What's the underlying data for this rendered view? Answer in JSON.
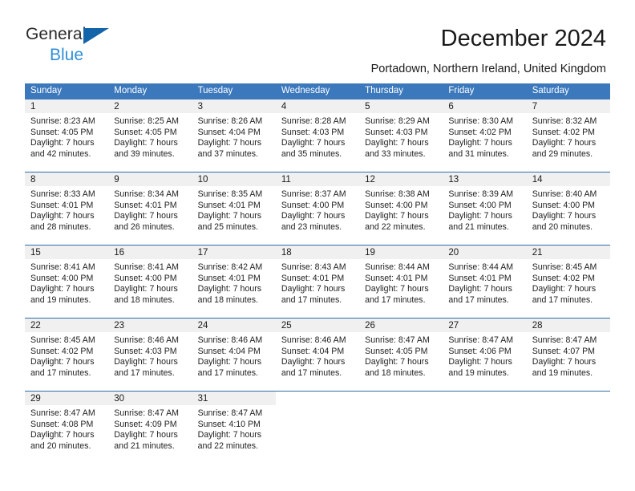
{
  "brand": {
    "name_part1": "General",
    "name_part2": "Blue",
    "triangle_color": "#1464aa",
    "blue_text_color": "#2f8fd8"
  },
  "header": {
    "title": "December 2024",
    "subtitle": "Portadown, Northern Ireland, United Kingdom"
  },
  "theme": {
    "header_row_bg": "#3b78bc",
    "row_separator": "#2e6da8",
    "daynum_bg": "#f0f0f0"
  },
  "weekdays": [
    "Sunday",
    "Monday",
    "Tuesday",
    "Wednesday",
    "Thursday",
    "Friday",
    "Saturday"
  ],
  "weeks": [
    [
      {
        "day": "1",
        "sunrise": "Sunrise: 8:23 AM",
        "sunset": "Sunset: 4:05 PM",
        "daylight_line1": "Daylight: 7 hours",
        "daylight_line2": "and 42 minutes."
      },
      {
        "day": "2",
        "sunrise": "Sunrise: 8:25 AM",
        "sunset": "Sunset: 4:05 PM",
        "daylight_line1": "Daylight: 7 hours",
        "daylight_line2": "and 39 minutes."
      },
      {
        "day": "3",
        "sunrise": "Sunrise: 8:26 AM",
        "sunset": "Sunset: 4:04 PM",
        "daylight_line1": "Daylight: 7 hours",
        "daylight_line2": "and 37 minutes."
      },
      {
        "day": "4",
        "sunrise": "Sunrise: 8:28 AM",
        "sunset": "Sunset: 4:03 PM",
        "daylight_line1": "Daylight: 7 hours",
        "daylight_line2": "and 35 minutes."
      },
      {
        "day": "5",
        "sunrise": "Sunrise: 8:29 AM",
        "sunset": "Sunset: 4:03 PM",
        "daylight_line1": "Daylight: 7 hours",
        "daylight_line2": "and 33 minutes."
      },
      {
        "day": "6",
        "sunrise": "Sunrise: 8:30 AM",
        "sunset": "Sunset: 4:02 PM",
        "daylight_line1": "Daylight: 7 hours",
        "daylight_line2": "and 31 minutes."
      },
      {
        "day": "7",
        "sunrise": "Sunrise: 8:32 AM",
        "sunset": "Sunset: 4:02 PM",
        "daylight_line1": "Daylight: 7 hours",
        "daylight_line2": "and 29 minutes."
      }
    ],
    [
      {
        "day": "8",
        "sunrise": "Sunrise: 8:33 AM",
        "sunset": "Sunset: 4:01 PM",
        "daylight_line1": "Daylight: 7 hours",
        "daylight_line2": "and 28 minutes."
      },
      {
        "day": "9",
        "sunrise": "Sunrise: 8:34 AM",
        "sunset": "Sunset: 4:01 PM",
        "daylight_line1": "Daylight: 7 hours",
        "daylight_line2": "and 26 minutes."
      },
      {
        "day": "10",
        "sunrise": "Sunrise: 8:35 AM",
        "sunset": "Sunset: 4:01 PM",
        "daylight_line1": "Daylight: 7 hours",
        "daylight_line2": "and 25 minutes."
      },
      {
        "day": "11",
        "sunrise": "Sunrise: 8:37 AM",
        "sunset": "Sunset: 4:00 PM",
        "daylight_line1": "Daylight: 7 hours",
        "daylight_line2": "and 23 minutes."
      },
      {
        "day": "12",
        "sunrise": "Sunrise: 8:38 AM",
        "sunset": "Sunset: 4:00 PM",
        "daylight_line1": "Daylight: 7 hours",
        "daylight_line2": "and 22 minutes."
      },
      {
        "day": "13",
        "sunrise": "Sunrise: 8:39 AM",
        "sunset": "Sunset: 4:00 PM",
        "daylight_line1": "Daylight: 7 hours",
        "daylight_line2": "and 21 minutes."
      },
      {
        "day": "14",
        "sunrise": "Sunrise: 8:40 AM",
        "sunset": "Sunset: 4:00 PM",
        "daylight_line1": "Daylight: 7 hours",
        "daylight_line2": "and 20 minutes."
      }
    ],
    [
      {
        "day": "15",
        "sunrise": "Sunrise: 8:41 AM",
        "sunset": "Sunset: 4:00 PM",
        "daylight_line1": "Daylight: 7 hours",
        "daylight_line2": "and 19 minutes."
      },
      {
        "day": "16",
        "sunrise": "Sunrise: 8:41 AM",
        "sunset": "Sunset: 4:00 PM",
        "daylight_line1": "Daylight: 7 hours",
        "daylight_line2": "and 18 minutes."
      },
      {
        "day": "17",
        "sunrise": "Sunrise: 8:42 AM",
        "sunset": "Sunset: 4:01 PM",
        "daylight_line1": "Daylight: 7 hours",
        "daylight_line2": "and 18 minutes."
      },
      {
        "day": "18",
        "sunrise": "Sunrise: 8:43 AM",
        "sunset": "Sunset: 4:01 PM",
        "daylight_line1": "Daylight: 7 hours",
        "daylight_line2": "and 17 minutes."
      },
      {
        "day": "19",
        "sunrise": "Sunrise: 8:44 AM",
        "sunset": "Sunset: 4:01 PM",
        "daylight_line1": "Daylight: 7 hours",
        "daylight_line2": "and 17 minutes."
      },
      {
        "day": "20",
        "sunrise": "Sunrise: 8:44 AM",
        "sunset": "Sunset: 4:01 PM",
        "daylight_line1": "Daylight: 7 hours",
        "daylight_line2": "and 17 minutes."
      },
      {
        "day": "21",
        "sunrise": "Sunrise: 8:45 AM",
        "sunset": "Sunset: 4:02 PM",
        "daylight_line1": "Daylight: 7 hours",
        "daylight_line2": "and 17 minutes."
      }
    ],
    [
      {
        "day": "22",
        "sunrise": "Sunrise: 8:45 AM",
        "sunset": "Sunset: 4:02 PM",
        "daylight_line1": "Daylight: 7 hours",
        "daylight_line2": "and 17 minutes."
      },
      {
        "day": "23",
        "sunrise": "Sunrise: 8:46 AM",
        "sunset": "Sunset: 4:03 PM",
        "daylight_line1": "Daylight: 7 hours",
        "daylight_line2": "and 17 minutes."
      },
      {
        "day": "24",
        "sunrise": "Sunrise: 8:46 AM",
        "sunset": "Sunset: 4:04 PM",
        "daylight_line1": "Daylight: 7 hours",
        "daylight_line2": "and 17 minutes."
      },
      {
        "day": "25",
        "sunrise": "Sunrise: 8:46 AM",
        "sunset": "Sunset: 4:04 PM",
        "daylight_line1": "Daylight: 7 hours",
        "daylight_line2": "and 17 minutes."
      },
      {
        "day": "26",
        "sunrise": "Sunrise: 8:47 AM",
        "sunset": "Sunset: 4:05 PM",
        "daylight_line1": "Daylight: 7 hours",
        "daylight_line2": "and 18 minutes."
      },
      {
        "day": "27",
        "sunrise": "Sunrise: 8:47 AM",
        "sunset": "Sunset: 4:06 PM",
        "daylight_line1": "Daylight: 7 hours",
        "daylight_line2": "and 19 minutes."
      },
      {
        "day": "28",
        "sunrise": "Sunrise: 8:47 AM",
        "sunset": "Sunset: 4:07 PM",
        "daylight_line1": "Daylight: 7 hours",
        "daylight_line2": "and 19 minutes."
      }
    ],
    [
      {
        "day": "29",
        "sunrise": "Sunrise: 8:47 AM",
        "sunset": "Sunset: 4:08 PM",
        "daylight_line1": "Daylight: 7 hours",
        "daylight_line2": "and 20 minutes."
      },
      {
        "day": "30",
        "sunrise": "Sunrise: 8:47 AM",
        "sunset": "Sunset: 4:09 PM",
        "daylight_line1": "Daylight: 7 hours",
        "daylight_line2": "and 21 minutes."
      },
      {
        "day": "31",
        "sunrise": "Sunrise: 8:47 AM",
        "sunset": "Sunset: 4:10 PM",
        "daylight_line1": "Daylight: 7 hours",
        "daylight_line2": "and 22 minutes."
      },
      {
        "day": "",
        "sunrise": "",
        "sunset": "",
        "daylight_line1": "",
        "daylight_line2": ""
      },
      {
        "day": "",
        "sunrise": "",
        "sunset": "",
        "daylight_line1": "",
        "daylight_line2": ""
      },
      {
        "day": "",
        "sunrise": "",
        "sunset": "",
        "daylight_line1": "",
        "daylight_line2": ""
      },
      {
        "day": "",
        "sunrise": "",
        "sunset": "",
        "daylight_line1": "",
        "daylight_line2": ""
      }
    ]
  ]
}
